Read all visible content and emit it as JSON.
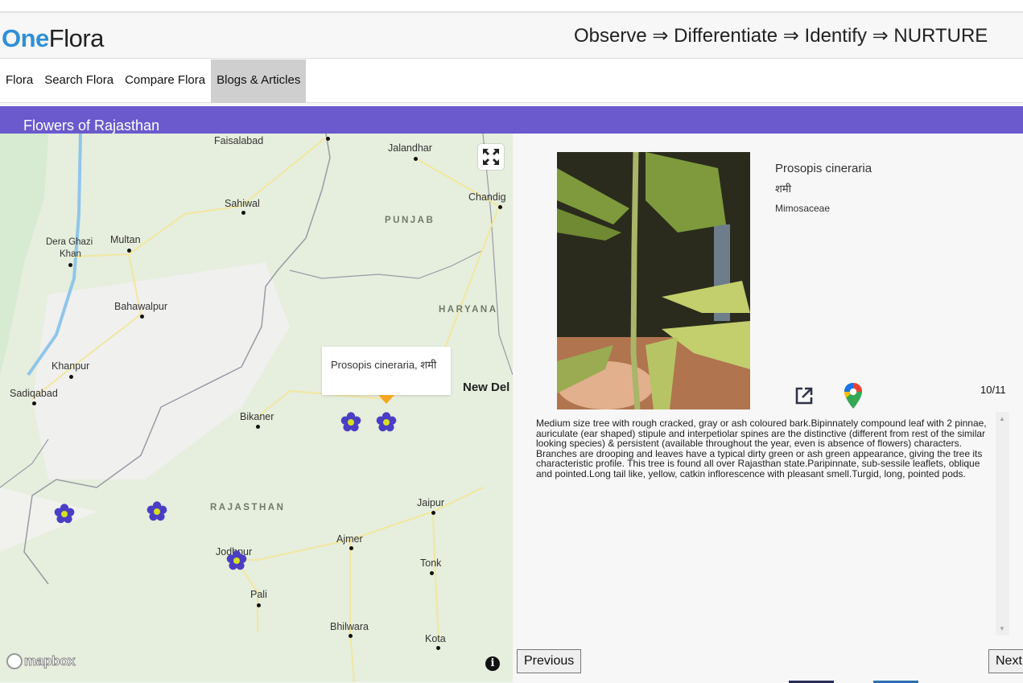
{
  "header": {
    "logo_part1": "One",
    "logo_part2": "Flora",
    "tagline": "Observe ⇒ Differentiate ⇒ Identify ⇒ NURTURE"
  },
  "nav": {
    "items": [
      {
        "label": "Flora",
        "active": false
      },
      {
        "label": "Search Flora",
        "active": false
      },
      {
        "label": "Compare Flora",
        "active": false
      },
      {
        "label": "Blogs & Articles",
        "active": true
      }
    ]
  },
  "banner": {
    "title": "Flowers of Rajasthan"
  },
  "map": {
    "cities": [
      "Faisalabad",
      "Jalandhar",
      "Sahiwal",
      "Chandig",
      "Multan",
      "Dera Ghazi",
      "Khan",
      "Bahawalpur",
      "Khanpur",
      "Sadiqabad",
      "Bikaner",
      "New Del",
      "Jaipur",
      "Ajmer",
      "Jodhpur",
      "Tonk",
      "Pali",
      "Bhilwara",
      "Kota"
    ],
    "states": [
      "PUNJAB",
      "HARYANA",
      "RAJASTHAN"
    ],
    "popup_text": "Prosopis cineraria, शमी",
    "attribution": "mapbox",
    "info_label": "i",
    "marker_count": 5,
    "colors": {
      "marker_petal": "#4a3fc4",
      "marker_center": "#d6e021",
      "popup_tip": "#f5a623"
    }
  },
  "detail": {
    "scientific_name": "Prosopis cineraria",
    "local_name": "शमी",
    "family": "Mimosaceae",
    "counter": "10/11",
    "description": "Medium size tree with rough cracked, gray or ash coloured bark.Bipinnately compound leaf with 2 pinnae, auriculate (ear shaped) stipule and interpetiolar spines are the distinctive (different from rest of the similar looking species) & persistent (available throughout the year, even is absence of flowers) characters. Branches are drooping and leaves have a typical dirty green or ash green appearance, giving the tree its characteristic profile. This tree is found all over Rajasthan state.Paripinnate, sub-sessile leaflets, oblique and pointed.Long tail like, yellow, catkin inflorescence with pleasant smell.Turgid, long, pointed pods.",
    "prev_label": "Previous",
    "next_label": "Next"
  },
  "colors": {
    "brand_blue": "#2f8fd8",
    "banner": "#6a5acd",
    "nav_active": "#cfcfcf"
  }
}
